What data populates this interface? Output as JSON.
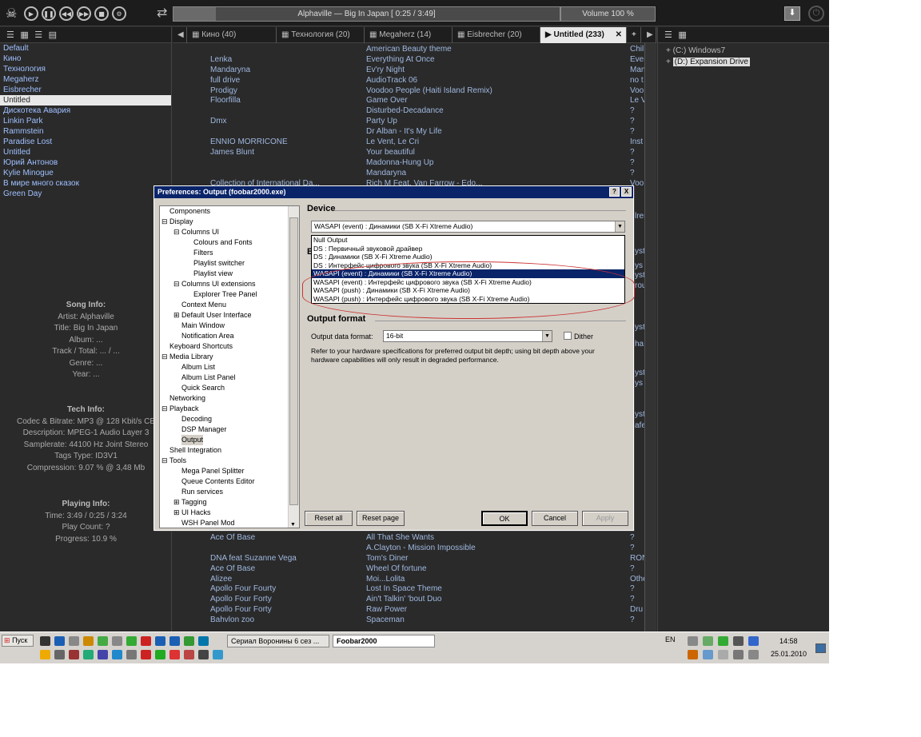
{
  "topbar": {
    "controls": [
      "play-icon",
      "pause-icon",
      "prev-icon",
      "next-icon",
      "stop-icon",
      "settings-icon"
    ],
    "now_playing": "Alphaville — Big In Japan  [ 0:25 / 3:49]",
    "progress_percent": 10.9,
    "volume": "Volume 100 %"
  },
  "left_header": "☰ ▦ ☰ ▤",
  "playlists": [
    "Default",
    "Кино",
    "Технология",
    "Megaherz",
    "Eisbrecher",
    "Untitled",
    "Дискотека Авария",
    "Linkin Park",
    "Rammstein",
    "Paradise Lost",
    "Untitled",
    "Юрий Антонов",
    "Kylie Minogue",
    "В мире много сказок",
    "Green Day"
  ],
  "song_info": {
    "header": "Song Info:",
    "lines": [
      "Artist: Alphaville",
      "Title: Big In Japan",
      "Album: ...",
      "Track / Total: ... / ...",
      "Genre: ...",
      "Year: ..."
    ]
  },
  "tech_info": {
    "header": "Tech Info:",
    "lines": [
      "Codec & Bitrate: MP3 @ 128 Kbit/s CE",
      "Description: MPEG-1 Audio Layer 3",
      "Samplerate: 44100 Hz Joint Stereo",
      "Tags Type: ID3V1",
      "Compression: 9.07 % @ 3,48 Mb"
    ]
  },
  "playing_info": {
    "header": "Playing Info:",
    "lines": [
      "Time: 3:49 / 0:25 / 3:24",
      "Play Count: ?",
      "Progress: 10.9 %"
    ]
  },
  "tabs": [
    {
      "label": "Кино (40)"
    },
    {
      "label": "Технология (20)"
    },
    {
      "label": "Megaherz (14)"
    },
    {
      "label": "Eisbrecher (20)"
    },
    {
      "label": "Untitled (233)",
      "active": true
    }
  ],
  "tab_nav": {
    "left": "◀",
    "add": "+",
    "right": "▶",
    "close": "✕"
  },
  "playlist_rows": [
    [
      "",
      "American Beauty theme",
      "Chil"
    ],
    [
      "Lenka",
      "Everything At Once",
      "Ever"
    ],
    [
      "Mandaryna",
      "Ev'ry Night",
      "Man"
    ],
    [
      "full drive",
      "AudioTrack 06",
      "no t"
    ],
    [
      "Prodigy",
      "Voodoo People (Haiti Island Remix)",
      "Voo"
    ],
    [
      "Floorfilla",
      "Game Over",
      "Le V"
    ],
    [
      "",
      "Disturbed-Decadance",
      "?"
    ],
    [
      "Dmx",
      "Party Up",
      "?"
    ],
    [
      "",
      "Dr Alban - It's My Life",
      "?"
    ],
    [
      "ENNIO MORRICONE",
      "Le Vent, Le Cri",
      "Inst"
    ],
    [
      "James Blunt",
      "Your beautiful",
      "?"
    ],
    [
      "",
      "Madonna-Hung Up",
      "?"
    ],
    [
      "",
      "Mandaryna",
      "?"
    ],
    [
      "Collection of International Da...",
      "Rich M Feat. Van Farrow - Edo...",
      "Voo"
    ]
  ],
  "playlist_rows_bottom": [
    [
      "Ace Of Base",
      "All That She Wants",
      "?"
    ],
    [
      "",
      "A.Clayton - Mission Impossible",
      "?"
    ],
    [
      "DNA feat Suzanne Vega",
      "Tom's Diner",
      "RON"
    ],
    [
      "Ace Of Base",
      "Wheel Of fortune",
      "?"
    ],
    [
      "Alizee",
      "Moi...Lolita",
      "Othe"
    ],
    [
      "Apollo Four Fourty",
      "Lost In Space Theme",
      "?"
    ],
    [
      "Apollo Four Forty",
      "Ain't Talkin' 'bout Duo",
      "?"
    ],
    [
      "Apollo Four Forty",
      "Raw Power",
      "Dru"
    ],
    [
      "Bahvlon zoo",
      "Spaceman",
      "?"
    ]
  ],
  "side_fragments": [
    "lren",
    "yst",
    "ys",
    "yst",
    "rou",
    "yst",
    "ha",
    "yst",
    "ys",
    "yst",
    "afe"
  ],
  "right_header": "☰ ▦",
  "explorer": [
    {
      "label": "(C:) Windows7"
    },
    {
      "label": "(D:) Expansion Drive",
      "selected": true
    }
  ],
  "dialog": {
    "title": "Preferences: Output (foobar2000.exe)",
    "help_btn": "?",
    "close_btn": "X",
    "tree": [
      {
        "label": "Components",
        "level": 0
      },
      {
        "label": "Display",
        "level": 0,
        "exp": "−"
      },
      {
        "label": "Columns UI",
        "level": 1,
        "exp": "−"
      },
      {
        "label": "Colours and Fonts",
        "level": 2
      },
      {
        "label": "Filters",
        "level": 2
      },
      {
        "label": "Playlist switcher",
        "level": 2
      },
      {
        "label": "Playlist view",
        "level": 2
      },
      {
        "label": "Columns UI extensions",
        "level": 1,
        "exp": "−"
      },
      {
        "label": "Explorer Tree Panel",
        "level": 2
      },
      {
        "label": "Context Menu",
        "level": 1
      },
      {
        "label": "Default User Interface",
        "level": 1,
        "exp": "+"
      },
      {
        "label": "Main Window",
        "level": 1
      },
      {
        "label": "Notification Area",
        "level": 1
      },
      {
        "label": "Keyboard Shortcuts",
        "level": 0
      },
      {
        "label": "Media Library",
        "level": 0,
        "exp": "−"
      },
      {
        "label": "Album List",
        "level": 1
      },
      {
        "label": "Album List Panel",
        "level": 1
      },
      {
        "label": "Quick Search",
        "level": 1
      },
      {
        "label": "Networking",
        "level": 0
      },
      {
        "label": "Playback",
        "level": 0,
        "exp": "−"
      },
      {
        "label": "Decoding",
        "level": 1
      },
      {
        "label": "DSP Manager",
        "level": 1
      },
      {
        "label": "Output",
        "level": 1,
        "selected": true
      },
      {
        "label": "Shell Integration",
        "level": 0
      },
      {
        "label": "Tools",
        "level": 0,
        "exp": "−"
      },
      {
        "label": "Mega Panel Splitter",
        "level": 1
      },
      {
        "label": "Queue Contents Editor",
        "level": 1
      },
      {
        "label": "Run services",
        "level": 1
      },
      {
        "label": "Tagging",
        "level": 1,
        "exp": "+"
      },
      {
        "label": "UI Hacks",
        "level": 1,
        "exp": "+"
      },
      {
        "label": "WSH Panel Mod",
        "level": 1
      }
    ],
    "device_label": "Device",
    "device_value": "WASAPI (event) : Динамики (SB X-Fi Xtreme Audio)",
    "device_options": [
      "Null Output",
      "DS : Первичный звуковой драйвер",
      "DS : Динамики (SB X-Fi Xtreme Audio)",
      "DS : Интерфейс цифрового звука (SB X-Fi Xtreme Audio)",
      "WASAPI (event) : Динамики (SB X-Fi Xtreme Audio)",
      "WASAPI (event) : Интерфейс цифрового звука (SB X-Fi Xtreme Audio)",
      "WASAPI (push) : Динамики (SB X-Fi Xtreme Audio)",
      "WASAPI (push) : Интерфейс цифрового звука (SB X-Fi Xtreme Audio)"
    ],
    "device_selected_index": 4,
    "buffer_fragment": "B",
    "output_format_label": "Output format",
    "output_data_format_label": "Output data format:",
    "output_data_format_value": "16-bit",
    "dither_label": "Dither",
    "description": "Refer to your hardware specifications for preferred output bit depth; using bit depth above your hardware capabilities will only result in degraded performance.",
    "buttons": {
      "reset_all": "Reset all",
      "reset_page": "Reset page",
      "ok": "OK",
      "cancel": "Cancel",
      "apply": "Apply"
    }
  },
  "taskbar": {
    "start_label": "Пуск",
    "tasks": [
      "Сериал Воронины 6 сез ...",
      "Foobar2000"
    ],
    "lang": "EN",
    "time": "14:58",
    "date": "25.01.2010"
  },
  "colors": {
    "accent": "#0a246a",
    "annotation": "#cc3333",
    "panel_bg": "#2a2a2a",
    "link_text": "#9fc0ff"
  }
}
